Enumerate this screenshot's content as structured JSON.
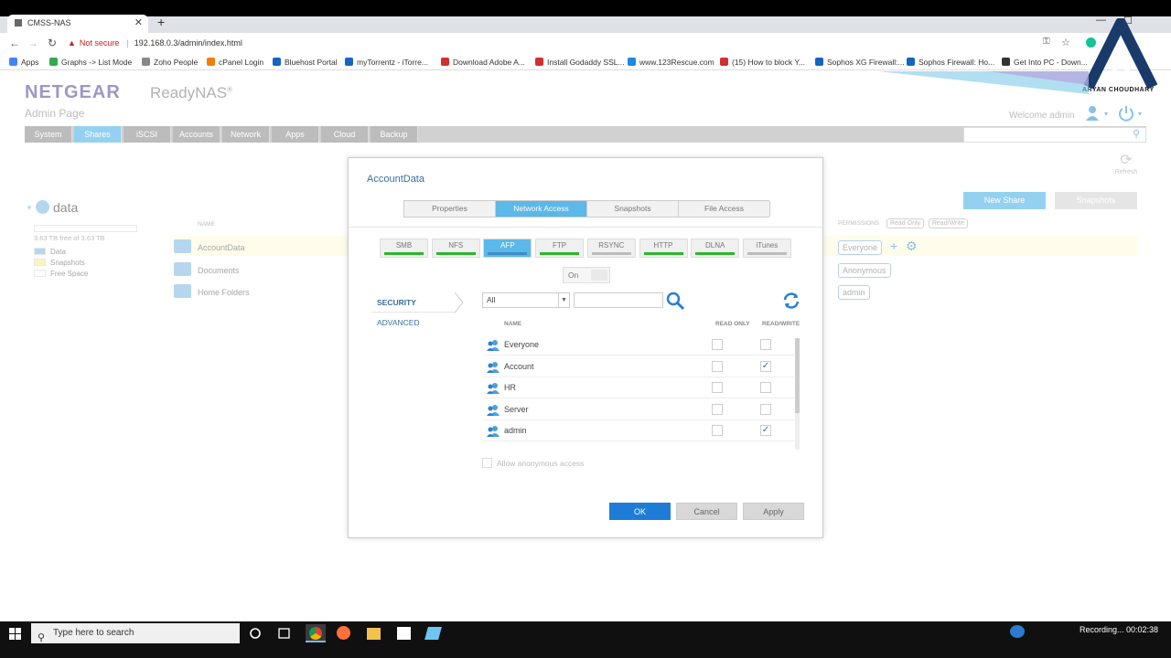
{
  "browser": {
    "tab_title": "CMSS-NAS",
    "not_secure": "Not secure",
    "url": "192.168.0.3/admin/index.html",
    "bookmarks": [
      {
        "label": "Apps",
        "color": "#4285f4"
      },
      {
        "label": "Graphs -> List Mode",
        "color": "#34a853"
      },
      {
        "label": "Zoho People",
        "color": "#888"
      },
      {
        "label": "cPanel Login",
        "color": "#f57c00"
      },
      {
        "label": "Bluehost Portal",
        "color": "#1565c0"
      },
      {
        "label": "myTorrentz - iTorre...",
        "color": "#1565c0"
      },
      {
        "label": "Download Adobe A...",
        "color": "#d32f2f"
      },
      {
        "label": "Install Godaddy SSL...",
        "color": "#d32f2f"
      },
      {
        "label": "www.123Rescue.com",
        "color": "#1e88e5"
      },
      {
        "label": "(15) How to block Y...",
        "color": "#d32f2f"
      },
      {
        "label": "Sophos XG Firewall:...",
        "color": "#1565c0"
      },
      {
        "label": "Sophos Firewall: Ho...",
        "color": "#1565c0"
      },
      {
        "label": "Get Into PC - Down...",
        "color": "#333"
      }
    ]
  },
  "header": {
    "brand": "NETGEAR",
    "product": "ReadyNAS",
    "reg": "®",
    "subtitle": "Admin Page",
    "welcome": "Welcome admin"
  },
  "nav": {
    "items": [
      "System",
      "Shares",
      "iSCSI",
      "Accounts",
      "Network",
      "Apps",
      "Cloud",
      "Backup"
    ],
    "active": "Shares"
  },
  "volume": {
    "name": "data",
    "free_text": "3.63 TB free of 3.63 TB",
    "legend": [
      {
        "label": "Data",
        "color": "#8fc1e6"
      },
      {
        "label": "Snapshots",
        "color": "#f7ef9a"
      },
      {
        "label": "Free Space",
        "color": "#ffffff"
      }
    ]
  },
  "shares": {
    "col_name": "NAME",
    "col_permissions": "PERMISSIONS",
    "perm_read_only": "Read Only",
    "perm_read_write": "Read/Write",
    "rows": [
      {
        "name": "AccountData",
        "perm": "Everyone"
      },
      {
        "name": "Documents",
        "perm": "Anonymous"
      },
      {
        "name": "Home Folders",
        "perm": "admin"
      }
    ],
    "new_share": "New Share",
    "snapshots": "Snapshots",
    "refresh": "Refresh"
  },
  "dialog": {
    "title": "AccountData",
    "tabs": [
      "Properties",
      "Network Access",
      "Snapshots",
      "File Access"
    ],
    "active_tab": "Network Access",
    "protocols": [
      {
        "label": "SMB",
        "enabled": true
      },
      {
        "label": "NFS",
        "enabled": true
      },
      {
        "label": "AFP",
        "enabled": true,
        "active": true
      },
      {
        "label": "FTP",
        "enabled": true
      },
      {
        "label": "RSYNC",
        "enabled": false
      },
      {
        "label": "HTTP",
        "enabled": true
      },
      {
        "label": "DLNA",
        "enabled": true
      },
      {
        "label": "iTunes",
        "enabled": false
      }
    ],
    "toggle": "On",
    "side_security": "SECURITY",
    "side_advanced": "ADVANCED",
    "filter_value": "All",
    "col_name": "NAME",
    "col_read_only": "READ ONLY",
    "col_read_write": "READ/WRITE",
    "users": [
      {
        "name": "Everyone",
        "ro": false,
        "rw": false
      },
      {
        "name": "Account",
        "ro": false,
        "rw": true
      },
      {
        "name": "HR",
        "ro": false,
        "rw": false
      },
      {
        "name": "Server",
        "ro": false,
        "rw": false
      },
      {
        "name": "admin",
        "ro": false,
        "rw": true
      }
    ],
    "allow_anonymous": "Allow anonymous access",
    "ok": "OK",
    "cancel": "Cancel",
    "apply": "Apply"
  },
  "taskbar": {
    "search_placeholder": "Type here to search",
    "recording": "Recording... 00:02:38"
  },
  "watermark": "ARYAN CHOUDHARY",
  "colors": {
    "accent": "#5bb8e8",
    "brand": "#6a5fa8",
    "ok": "#1f7cd6"
  }
}
